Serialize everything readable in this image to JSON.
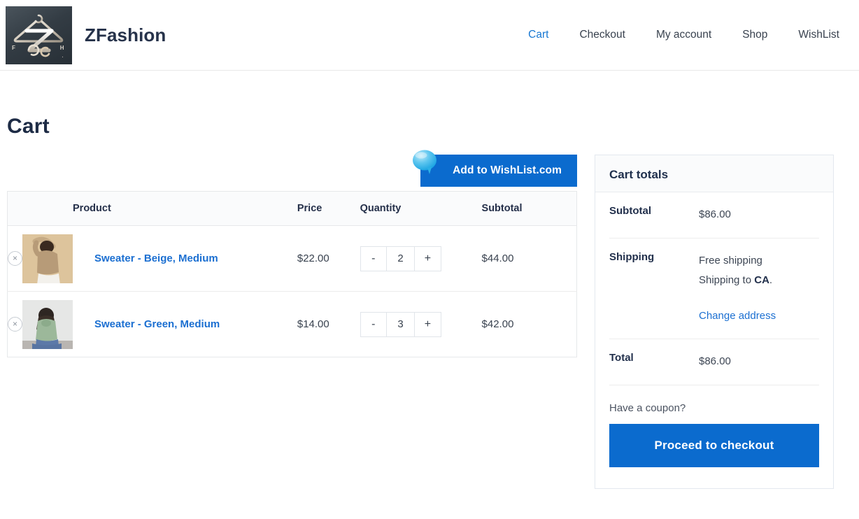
{
  "header": {
    "brand_name": "ZFashion",
    "logo_letters": {
      "left": "F",
      "right": "H",
      "dot": "."
    },
    "nav": [
      {
        "label": "Cart",
        "active": true
      },
      {
        "label": "Checkout",
        "active": false
      },
      {
        "label": "My account",
        "active": false
      },
      {
        "label": "Shop",
        "active": false
      },
      {
        "label": "WishList",
        "active": false
      }
    ]
  },
  "page": {
    "title": "Cart"
  },
  "wishlist": {
    "button_label": "Add to WishList.com"
  },
  "cart_table": {
    "columns": [
      "",
      "Product",
      "Price",
      "Quantity",
      "Subtotal"
    ],
    "rows": [
      {
        "remove_label": "×",
        "name": "Sweater - Beige, Medium",
        "price": "$22.00",
        "qty_minus": "-",
        "qty": "2",
        "qty_plus": "+",
        "subtotal": "$44.00"
      },
      {
        "remove_label": "×",
        "name": "Sweater - Green, Medium",
        "price": "$14.00",
        "qty_minus": "-",
        "qty": "3",
        "qty_plus": "+",
        "subtotal": "$42.00"
      }
    ]
  },
  "totals": {
    "title": "Cart totals",
    "subtotal_label": "Subtotal",
    "subtotal_value": "$86.00",
    "shipping_label": "Shipping",
    "shipping_method": "Free shipping",
    "shipping_to_prefix": "Shipping to ",
    "shipping_to_region": "CA",
    "shipping_to_suffix": ".",
    "change_address_label": "Change address",
    "total_label": "Total",
    "total_value": "$86.00",
    "coupon_label": "Have a coupon?",
    "checkout_label": "Proceed to checkout"
  },
  "colors": {
    "accent_blue": "#0b6bce",
    "link_blue": "#1b6fd1",
    "heading_navy": "#20304d",
    "border_gray": "#e6e8ea",
    "header_bg": "#fafbfc"
  }
}
